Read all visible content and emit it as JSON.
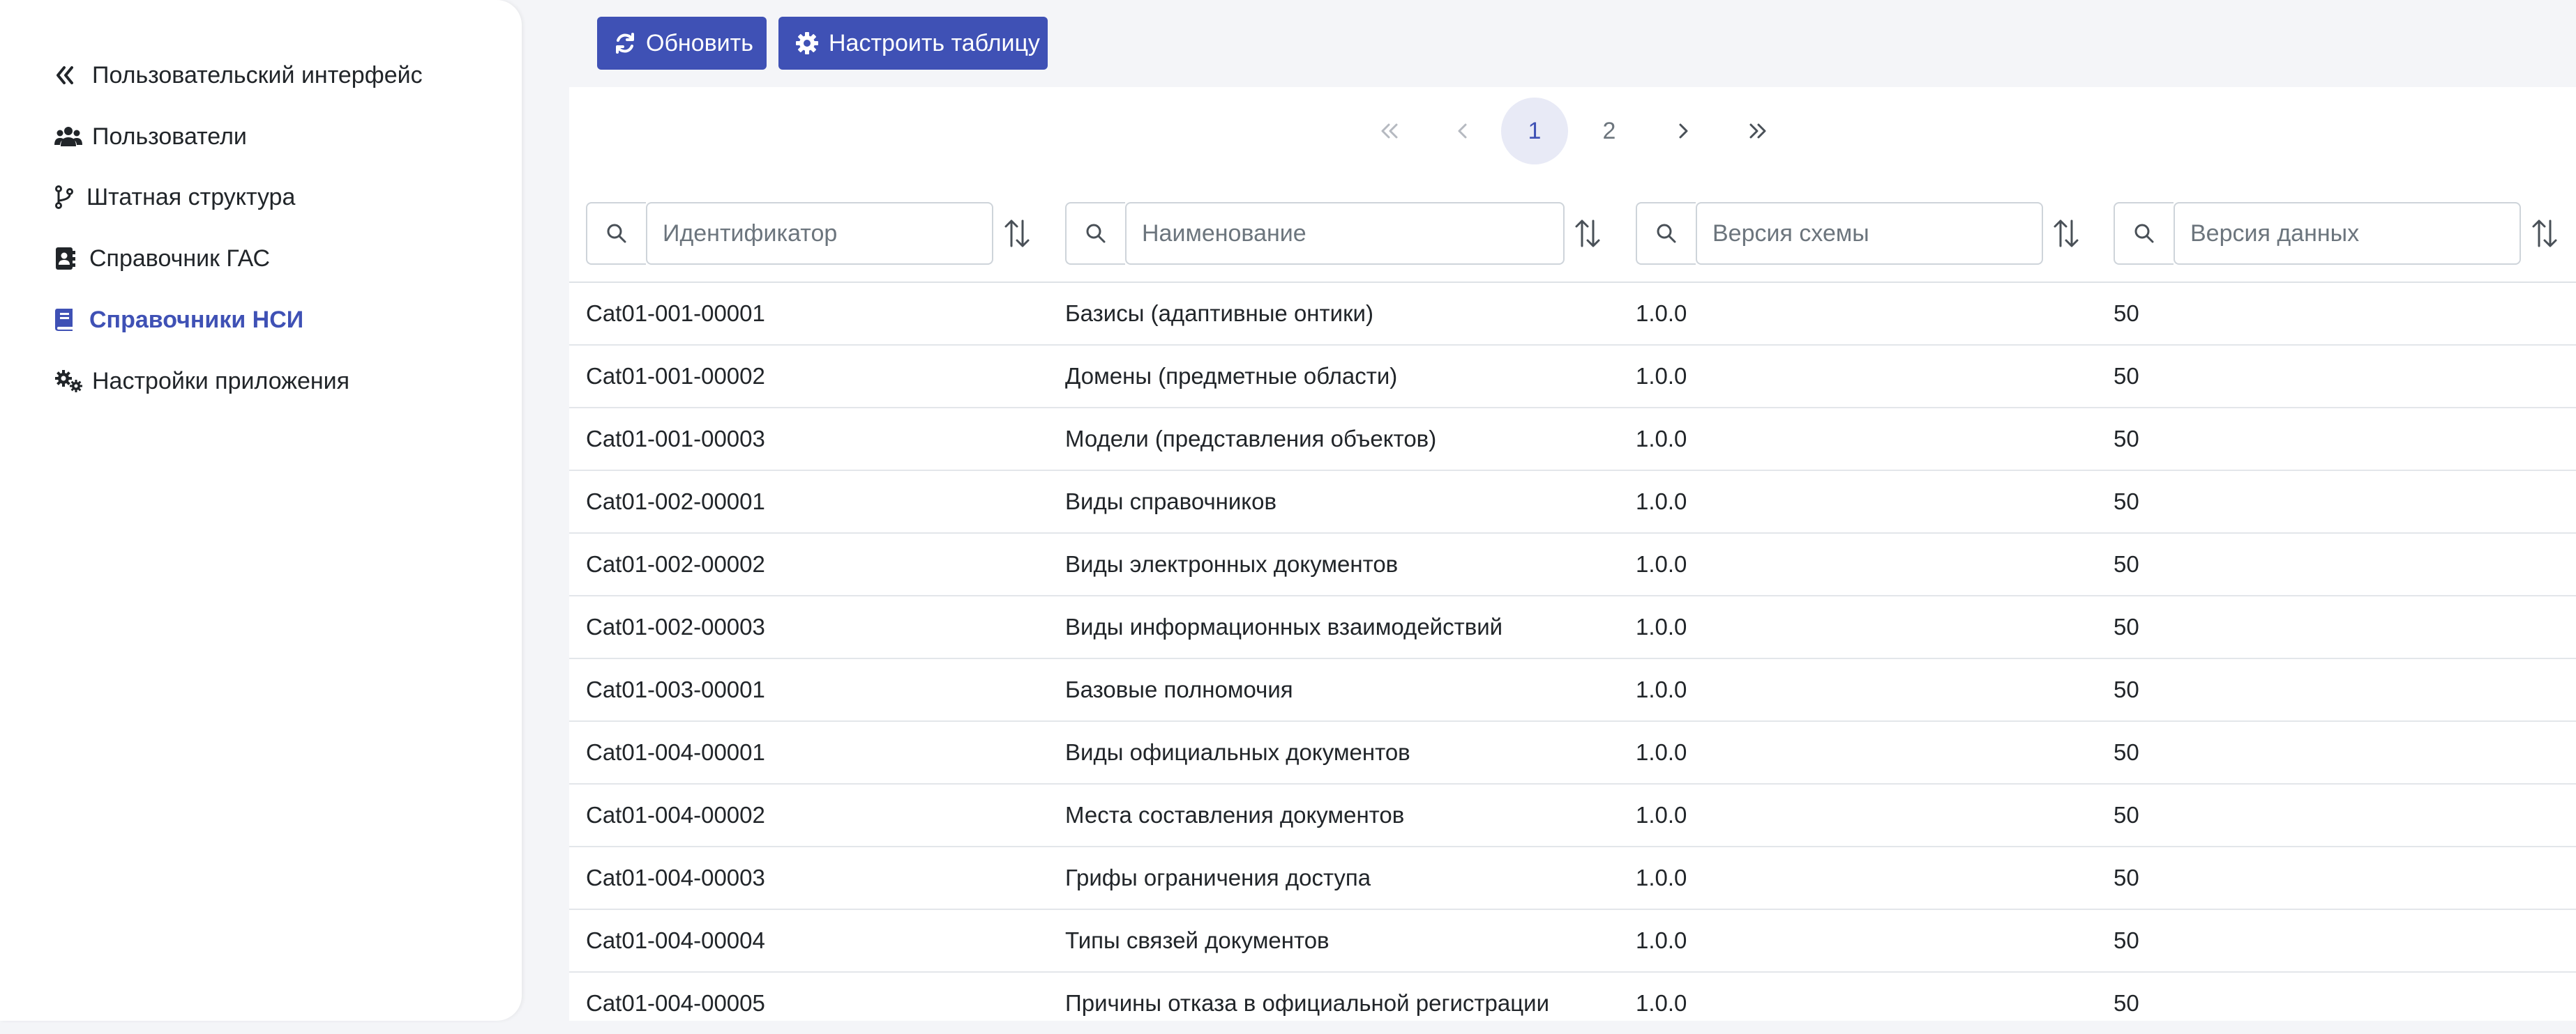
{
  "sidebar": {
    "items": [
      {
        "label": "Пользовательский интерфейс",
        "icon": "double-chevron-left-icon"
      },
      {
        "label": "Пользователи",
        "icon": "users-icon"
      },
      {
        "label": "Штатная структура",
        "icon": "code-branch-icon"
      },
      {
        "label": "Справочник ГАС",
        "icon": "address-book-icon"
      },
      {
        "label": "Справочники НСИ",
        "icon": "book-icon",
        "active": true
      },
      {
        "label": "Настройки приложения",
        "icon": "gears-icon"
      }
    ]
  },
  "toolbar": {
    "refresh_label": "Обновить",
    "configure_label": "Настроить таблицу"
  },
  "pagination": {
    "current_page": "1",
    "page_2": "2"
  },
  "filters": {
    "identifier_placeholder": "Идентификатор",
    "name_placeholder": "Наименование",
    "schema_version_placeholder": "Версия схемы",
    "data_version_placeholder": "Версия данных"
  },
  "table": {
    "rows": [
      [
        "Cat01-001-00001",
        "Базисы (адаптивные онтики)",
        "1.0.0",
        "50"
      ],
      [
        "Cat01-001-00002",
        "Домены (предметные области)",
        "1.0.0",
        "50"
      ],
      [
        "Cat01-001-00003",
        "Модели (представления объектов)",
        "1.0.0",
        "50"
      ],
      [
        "Cat01-002-00001",
        "Виды справочников",
        "1.0.0",
        "50"
      ],
      [
        "Cat01-002-00002",
        "Виды электронных документов",
        "1.0.0",
        "50"
      ],
      [
        "Cat01-002-00003",
        "Виды информационных взаимодействий",
        "1.0.0",
        "50"
      ],
      [
        "Cat01-003-00001",
        "Базовые полномочия",
        "1.0.0",
        "50"
      ],
      [
        "Cat01-004-00001",
        "Виды официальных документов",
        "1.0.0",
        "50"
      ],
      [
        "Cat01-004-00002",
        "Места составления документов",
        "1.0.0",
        "50"
      ],
      [
        "Cat01-004-00003",
        "Грифы ограничения доступа",
        "1.0.0",
        "50"
      ],
      [
        "Cat01-004-00004",
        "Типы связей документов",
        "1.0.0",
        "50"
      ],
      [
        "Cat01-004-00005",
        "Причины отказа в официальной регистрации",
        "1.0.0",
        "50"
      ]
    ]
  },
  "colors": {
    "accent": "#3f51b5",
    "pager_active_bg": "#e8eaf6",
    "background": "#f4f5f8"
  }
}
